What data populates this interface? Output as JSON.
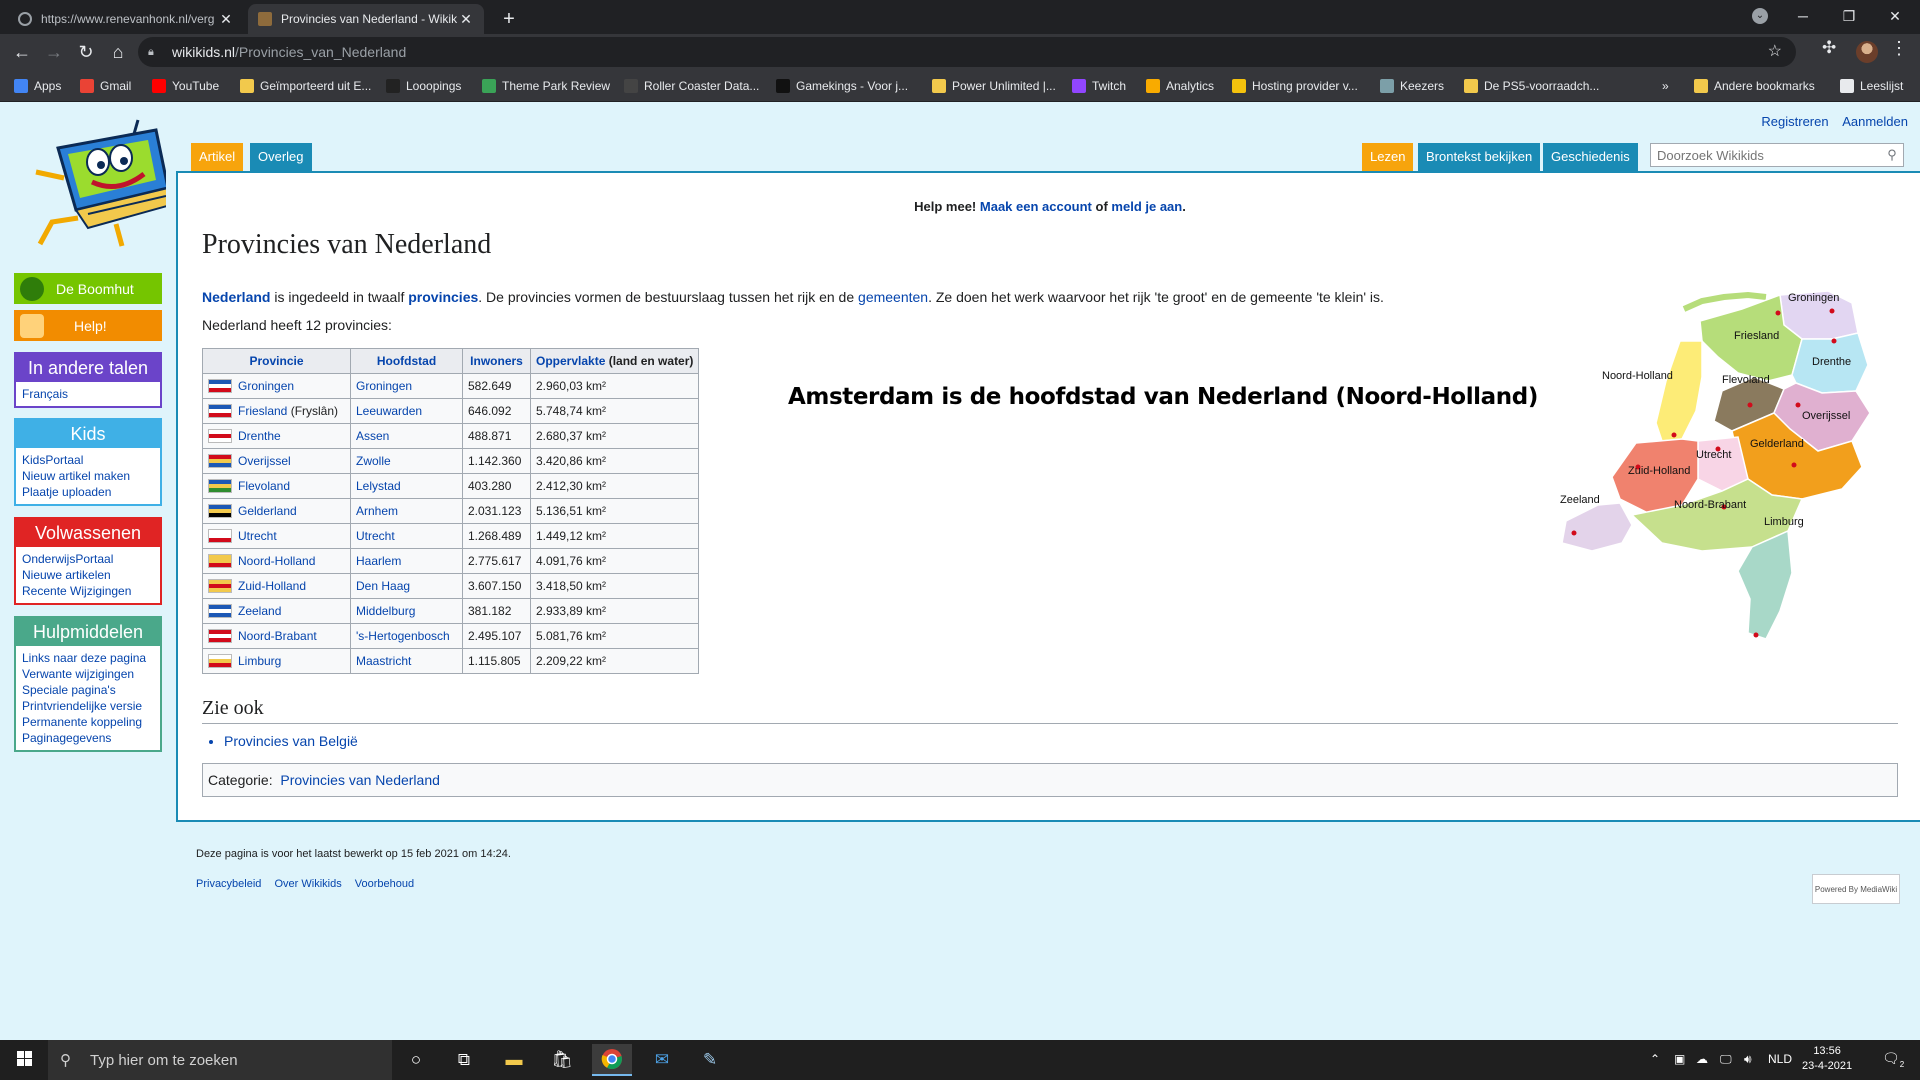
{
  "browser": {
    "tabs": [
      {
        "title": "https://www.renevanhonk.nl/verg",
        "active": false
      },
      {
        "title": "Provincies van Nederland - Wikik",
        "active": true
      }
    ],
    "url_host": "wikikids.nl",
    "url_path": "/Provincies_van_Nederland",
    "bookmarks": [
      {
        "label": "Apps",
        "color": "#4285f4"
      },
      {
        "label": "Gmail",
        "color": "#ea4335"
      },
      {
        "label": "YouTube",
        "color": "#ff0000"
      },
      {
        "label": "Geïmporteerd uit E...",
        "color": "#f2c94c"
      },
      {
        "label": "Looopings",
        "color": "#222222"
      },
      {
        "label": "Theme Park Review",
        "color": "#3aa357"
      },
      {
        "label": "Roller Coaster Data...",
        "color": "#444444"
      },
      {
        "label": "Gamekings - Voor j...",
        "color": "#111111"
      },
      {
        "label": "Power Unlimited |...",
        "color": "#f2c94c"
      },
      {
        "label": "Twitch",
        "color": "#9146ff"
      },
      {
        "label": "Analytics",
        "color": "#f9ab00"
      },
      {
        "label": "Hosting provider v...",
        "color": "#f4c20d"
      },
      {
        "label": "Keezers",
        "color": "#7c9fa8"
      },
      {
        "label": "De PS5-voorraadch...",
        "color": "#f2c94c"
      }
    ],
    "bookmarks_more": "»",
    "other_bookmarks": "Andere bookmarks",
    "reading_list": "Leeslijst"
  },
  "wiki": {
    "personal": [
      "Registreren",
      "Aanmelden"
    ],
    "namespace_tabs": [
      "Artikel",
      "Overleg"
    ],
    "view_tabs": [
      "Lezen",
      "Brontekst bekijken",
      "Geschiedenis"
    ],
    "search_placeholder": "Doorzoek Wikikids",
    "sidebar": {
      "boomhut": "De Boomhut",
      "help": "Help!",
      "talen": {
        "title": "In andere talen",
        "items": [
          "Français"
        ]
      },
      "kids": {
        "title": "Kids",
        "items": [
          "KidsPortaal",
          "Nieuw artikel maken",
          "Plaatje uploaden"
        ]
      },
      "volwassenen": {
        "title": "Volwassenen",
        "items": [
          "OnderwijsPortaal",
          "Nieuwe artikelen",
          "Recente Wijzigingen"
        ]
      },
      "hulpmiddelen": {
        "title": "Hulpmiddelen",
        "items": [
          "Links naar deze pagina",
          "Verwante wijzigingen",
          "Speciale pagina's",
          "Printvriendelijke versie",
          "Permanente koppeling",
          "Paginagegevens"
        ]
      }
    },
    "sitenotice": {
      "prefix": "Help mee!",
      "link1": "Maak een account",
      "mid": "of",
      "link2": "meld je aan",
      "end": "."
    },
    "title": "Provincies van Nederland",
    "intro": {
      "w1": "Nederland",
      "t1": " is ingedeeld in twaalf ",
      "w2": "provincies",
      "t2": ". De provincies vormen de bestuurslaag tussen het rijk en de ",
      "w3": "gemeenten",
      "t3": ". Ze doen het werk waarvoor het rijk 'te groot' en de gemeente 'te klein' is."
    },
    "count_line": "Nederland heeft 12 provincies:",
    "table": {
      "headers": [
        "Provincie",
        "Hoofdstad",
        "Inwoners",
        "Oppervlakte",
        "(land en water)"
      ],
      "rows": [
        {
          "provincie": "Groningen",
          "extra": "",
          "hoofdstad": "Groningen",
          "inwoners": "582.649",
          "oppervlakte": "2.960,03 km²"
        },
        {
          "provincie": "Friesland",
          "extra": " (Fryslân)",
          "hoofdstad": "Leeuwarden",
          "inwoners": "646.092",
          "oppervlakte": "5.748,74 km²"
        },
        {
          "provincie": "Drenthe",
          "extra": "",
          "hoofdstad": "Assen",
          "inwoners": "488.871",
          "oppervlakte": "2.680,37 km²"
        },
        {
          "provincie": "Overijssel",
          "extra": "",
          "hoofdstad": "Zwolle",
          "inwoners": "1.142.360",
          "oppervlakte": "3.420,86 km²"
        },
        {
          "provincie": "Flevoland",
          "extra": "",
          "hoofdstad": "Lelystad",
          "inwoners": "403.280",
          "oppervlakte": "2.412,30 km²"
        },
        {
          "provincie": "Gelderland",
          "extra": "",
          "hoofdstad": "Arnhem",
          "inwoners": "2.031.123",
          "oppervlakte": "5.136,51 km²"
        },
        {
          "provincie": "Utrecht",
          "extra": "",
          "hoofdstad": "Utrecht",
          "inwoners": "1.268.489",
          "oppervlakte": "1.449,12 km²"
        },
        {
          "provincie": "Noord-Holland",
          "extra": "",
          "hoofdstad": "Haarlem",
          "inwoners": "2.775.617",
          "oppervlakte": "4.091,76 km²"
        },
        {
          "provincie": "Zuid-Holland",
          "extra": "",
          "hoofdstad": "Den Haag",
          "inwoners": "3.607.150",
          "oppervlakte": "3.418,50 km²"
        },
        {
          "provincie": "Zeeland",
          "extra": "",
          "hoofdstad": "Middelburg",
          "inwoners": "381.182",
          "oppervlakte": "2.933,89 km²"
        },
        {
          "provincie": "Noord-Brabant",
          "extra": "",
          "hoofdstad": "'s-Hertogenbosch",
          "inwoners": "2.495.107",
          "oppervlakte": "5.081,76 km²"
        },
        {
          "provincie": "Limburg",
          "extra": "",
          "hoofdstad": "Maastricht",
          "inwoners": "1.115.805",
          "oppervlakte": "2.209,22 km²"
        }
      ]
    },
    "big_claim": "Amsterdam is de hoofdstad van Nederland (Noord-Holland)",
    "map_labels": [
      "Groningen",
      "Friesland",
      "Drenthe",
      "Noord-Holland",
      "Flevoland",
      "Overijssel",
      "Gelderland",
      "Utrecht",
      "Zuid-Holland",
      "Zeeland",
      "Noord-Brabant",
      "Limburg"
    ],
    "zie_ook": "Zie ook",
    "zie_ook_items": [
      "Provincies van België"
    ],
    "category_label": "Categorie:",
    "category": "Provincies van Nederland",
    "footer_modified": "Deze pagina is voor het laatst bewerkt op 15 feb 2021 om 14:24.",
    "footer_links": [
      "Privacybeleid",
      "Over Wikikids",
      "Voorbehoud"
    ],
    "powered_by": "Powered By MediaWiki"
  },
  "taskbar": {
    "search_placeholder": "Typ hier om te zoeken",
    "language": "NLD",
    "time": "13:56",
    "date": "23-4-2021",
    "notification_count": "2"
  }
}
